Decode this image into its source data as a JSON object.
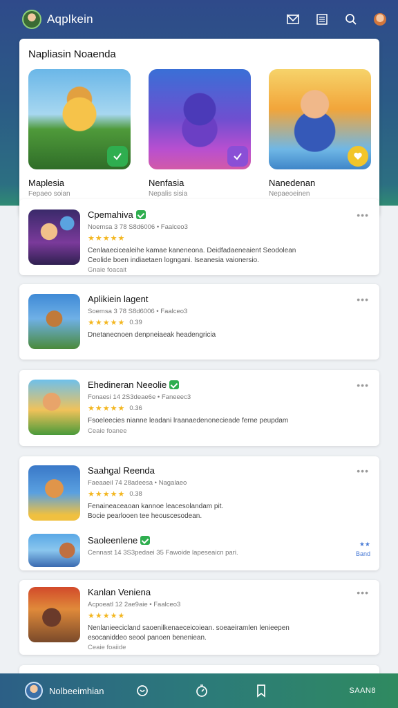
{
  "app": {
    "title": "Aqplkein"
  },
  "header_icons": [
    "mail-icon",
    "list-icon",
    "search-icon",
    "profile-icon"
  ],
  "featured": {
    "title": "Napliasin Noaenda",
    "items": [
      {
        "name": "Maplesia",
        "sub": "Fepaeo soian"
      },
      {
        "name": "Nenfasia",
        "sub": "Nepalis sisia"
      },
      {
        "name": "Nanedenan",
        "sub": "Nepaeoeinen"
      }
    ]
  },
  "list": [
    {
      "name": "Cpemahiva",
      "verified": true,
      "meta": "Noemsa 3 78 S8d6006 • Faalceo3",
      "stars": "★★★★★",
      "rating": "",
      "desc": [
        "Cenlaaecicealeihe kamae kaneneona. Deidfadaeneaient Seodolean",
        "Ceolide boen indiaetaen logngani. Iseanesia vaionersio."
      ],
      "note": "Gnaie foacait"
    },
    {
      "name": "Aplikiein lagent",
      "verified": false,
      "meta": "Soemsa 3 78 S8d6006 • Faalceo3",
      "stars": "★★★★★",
      "rating": "0.39",
      "desc": [
        "Dnetanecnoen denpneiaeak headengricia"
      ],
      "note": ""
    },
    {
      "name": "Ehedineran Neeolie",
      "verified": true,
      "meta": "Fonaesi 14 2S3deae6e • Faneeec3",
      "stars": "★★★★★",
      "rating": "0.36",
      "desc": [
        "Fsoeleecies nianne leadani lraanaedenonecieade ferne peupdam"
      ],
      "note": "Ceaie foanee"
    },
    {
      "name": "Saahgal Reenda",
      "verified": false,
      "meta": "Faeaaeil 74 28adeesa • Nagalaeo",
      "stars": "★★★★★",
      "rating": "0.38",
      "desc": [
        "Fenaineaceaoan kannoe leacesolandam pit.",
        "Bocie pearlooen tee heouscesodean."
      ],
      "note": ""
    },
    {
      "name": "Saoleenlene",
      "verified": true,
      "meta": "Cennast 14 3S3pedaei 35 Fawoide lapeseaicn pari.",
      "stars": "",
      "rating": "",
      "desc": [],
      "note": "",
      "side": [
        "★★",
        "Band"
      ]
    },
    {
      "name": "Kanlan Veniena",
      "verified": false,
      "meta": "Acpoeatl 12 2ae9aie • Faalceo3",
      "stars": "★★★★★",
      "rating": "",
      "desc": [
        "Nenlanieecicland saoenilkenaeceicoiean. soeaeiramlen lenieepen",
        "esocaniddeo seool panoen beneniean."
      ],
      "note": "Ceaie foaiide"
    }
  ],
  "bottom": {
    "label": "Nolbeeimhian",
    "icons": [
      "chat-icon",
      "timer-icon",
      "bookmark-icon"
    ],
    "right": "SAAN8"
  },
  "colors": {
    "accent": "#2fae4f",
    "star": "#f3b61f",
    "header_top": "#2f4a8a",
    "header_bottom": "#2f8a74"
  }
}
